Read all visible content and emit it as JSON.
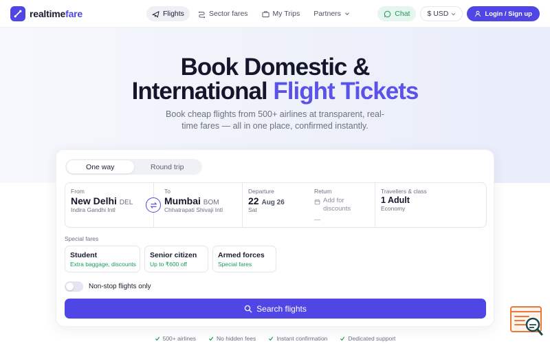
{
  "brand": {
    "name_part1": "realtime",
    "name_part2": "fare"
  },
  "nav": {
    "links": [
      {
        "label": "Flights",
        "icon": "plane-icon",
        "active": true
      },
      {
        "label": "Sector fares",
        "icon": "route-icon",
        "active": false
      },
      {
        "label": "My Trips",
        "icon": "briefcase-icon",
        "active": false
      },
      {
        "label": "Partners",
        "icon": "chevron-down-icon",
        "active": false
      }
    ],
    "chat_label": "Chat",
    "currency_label": "$ USD",
    "login_label": "Login / Sign up"
  },
  "hero": {
    "title_line1": "Book Domestic &",
    "title_line2_plain": "International ",
    "title_line2_accent": "Flight Tickets",
    "subtitle": "Book cheap flights from 500+ airlines at transparent, real-time fares — all in one place, confirmed instantly."
  },
  "search": {
    "trip_types": [
      "One way",
      "Round trip"
    ],
    "selected_trip": "One way",
    "from": {
      "label": "From",
      "city": "New Delhi",
      "code": "DEL",
      "airport": "Indira Gandhi Intl"
    },
    "to": {
      "label": "To",
      "city": "Mumbai",
      "code": "BOM",
      "airport": "Chhatrapati Shivaji Intl"
    },
    "departure": {
      "label": "Departure",
      "day": "22",
      "month_year": "Aug 26",
      "weekday": "Sat"
    },
    "return": {
      "label": "Return",
      "placeholder": "Add for discounts",
      "dash": "—"
    },
    "travellers": {
      "label": "Travellers & class",
      "count": "1 Adult",
      "class": "Economy"
    },
    "special_fares_label": "Special fares",
    "special_fares": [
      {
        "title": "Student",
        "subtitle": "Extra baggage, discounts"
      },
      {
        "title": "Senior citizen",
        "subtitle": "Up to ₹600 off"
      },
      {
        "title": "Armed forces",
        "subtitle": "Special fares"
      }
    ],
    "nonstop_label": "Non-stop flights only",
    "search_button": "Search flights"
  },
  "trust": [
    "500+ airlines",
    "No hidden fees",
    "Instant confirmation",
    "Dedicated support"
  ],
  "colors": {
    "primary": "#4f46e5",
    "accent_text": "#5b52e8",
    "success": "#1a9a5a",
    "widget": "#e8793a"
  }
}
